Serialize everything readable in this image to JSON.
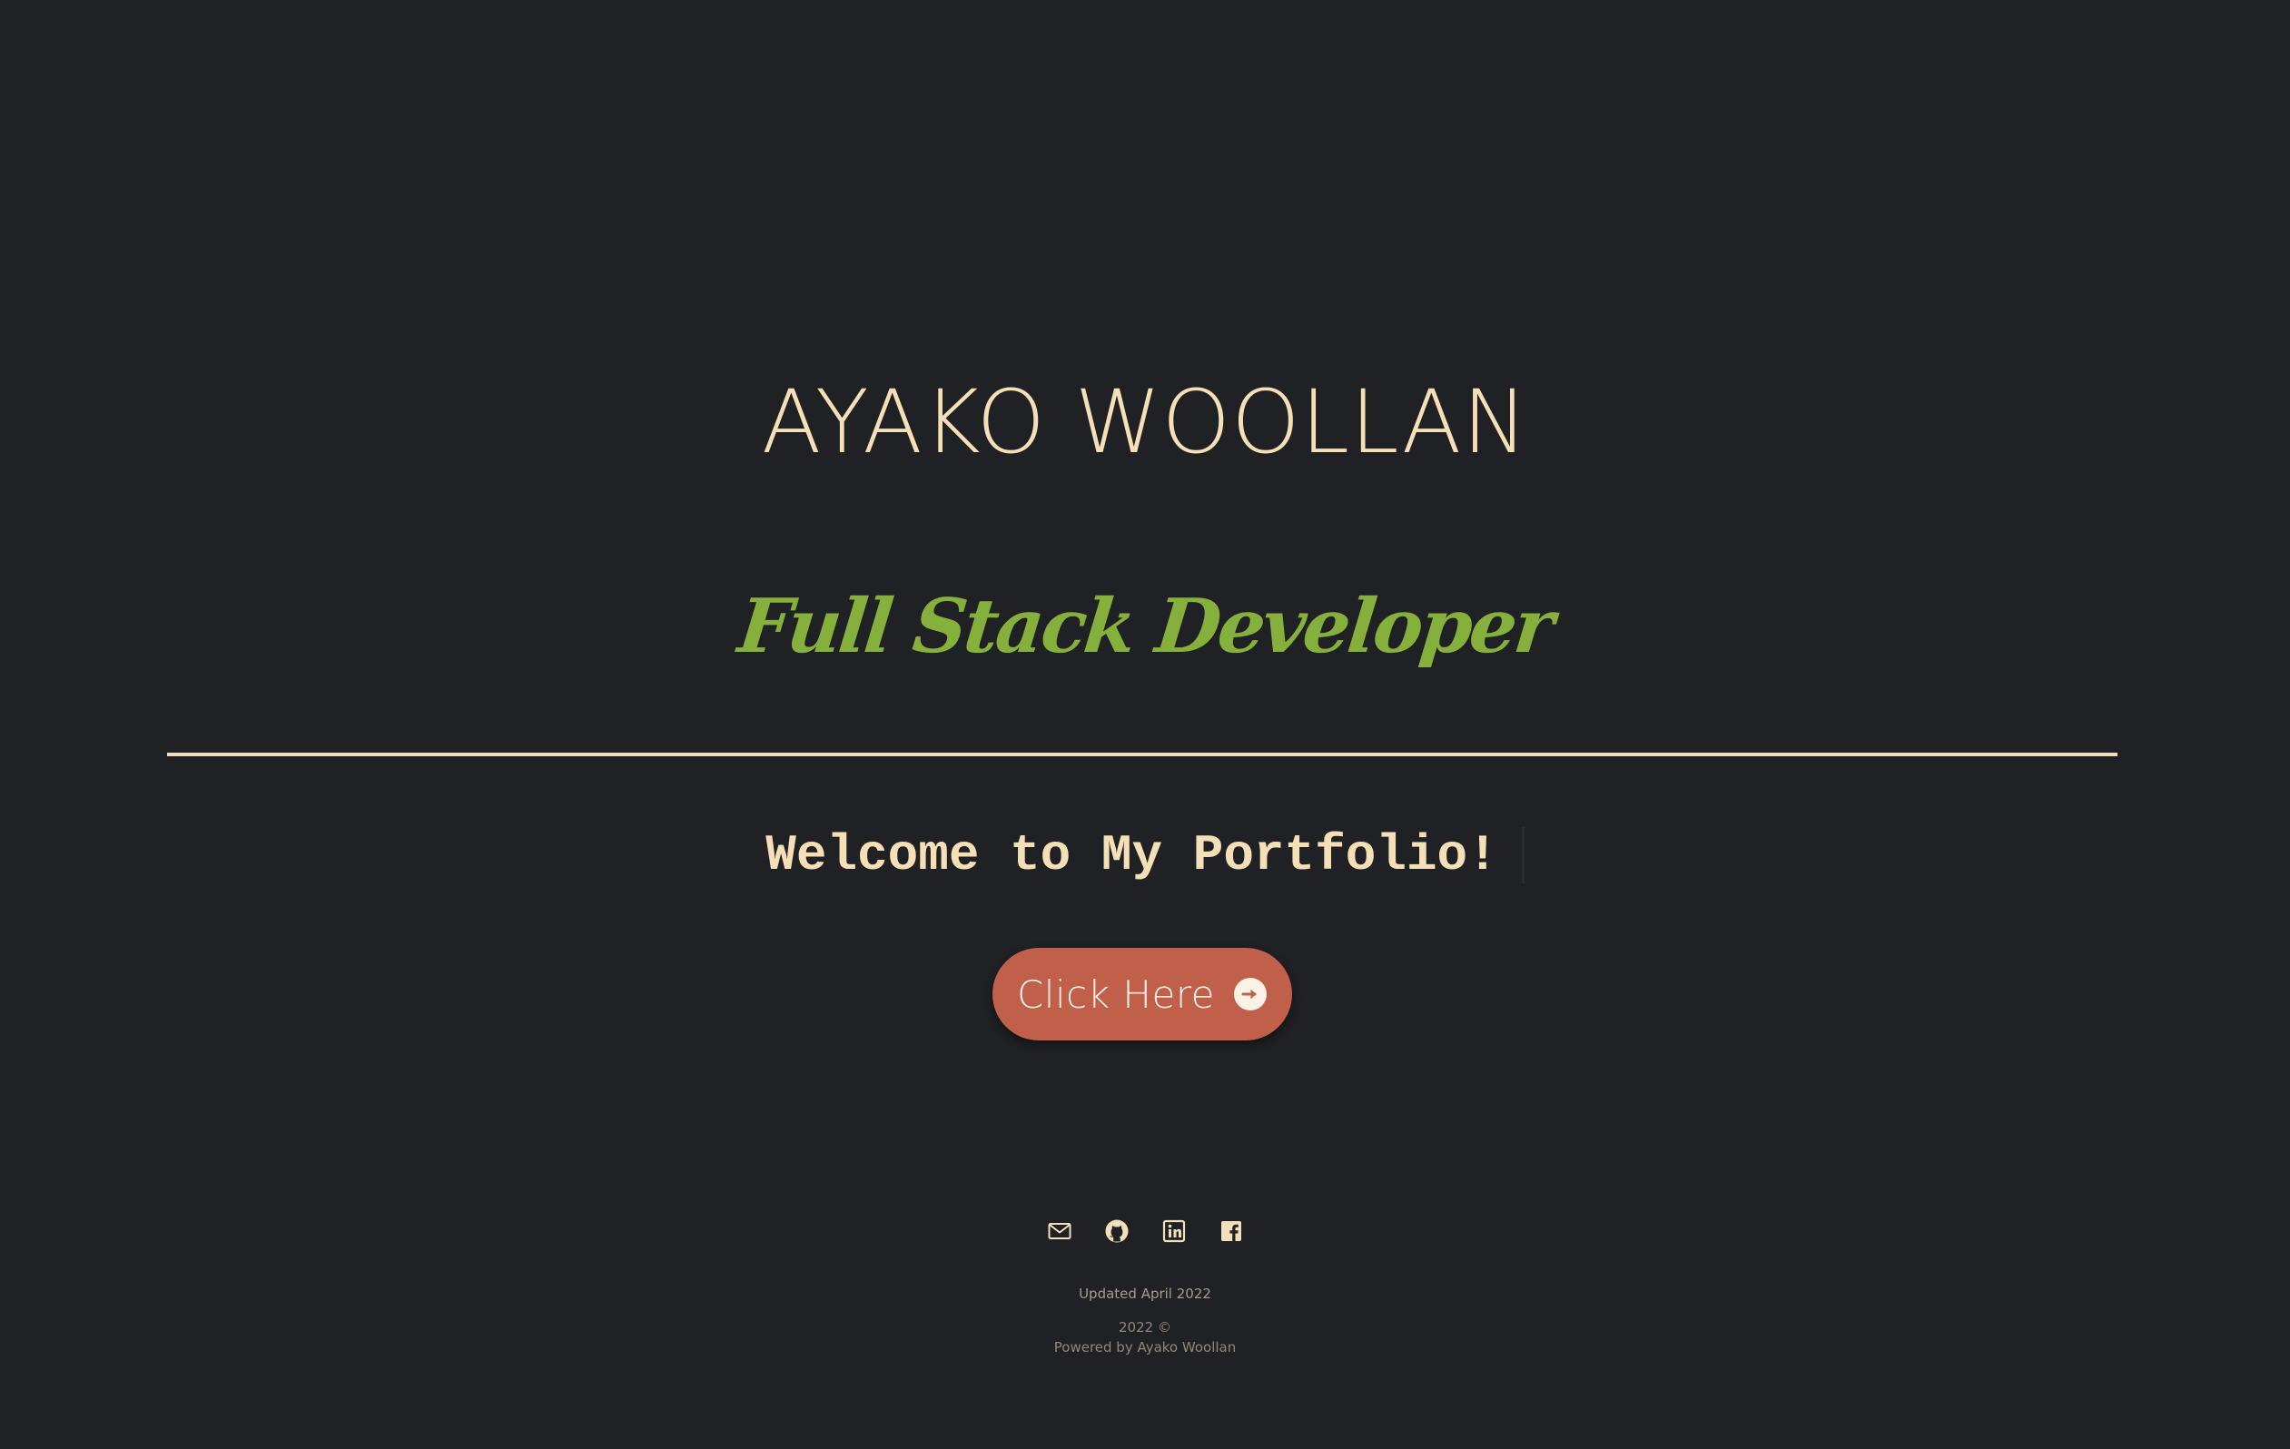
{
  "hero": {
    "name": "AYAKO WOOLLAN",
    "subtitle": "Full Stack Developer"
  },
  "welcome": {
    "text": "Welcome to My Portfolio!"
  },
  "cta": {
    "label": "Click Here",
    "icon": "arrow-right-circle-icon"
  },
  "socials": [
    {
      "icon": "email-icon"
    },
    {
      "icon": "github-icon"
    },
    {
      "icon": "linkedin-icon"
    },
    {
      "icon": "facebook-icon"
    }
  ],
  "footer": {
    "updated": "Updated April 2022",
    "copyright": "2022 ©",
    "powered": "Powered by Ayako Woollan"
  },
  "colors": {
    "background": "#202124",
    "cream": "#f5dfb6",
    "green": "#86b03c",
    "button": "#c0604b"
  }
}
